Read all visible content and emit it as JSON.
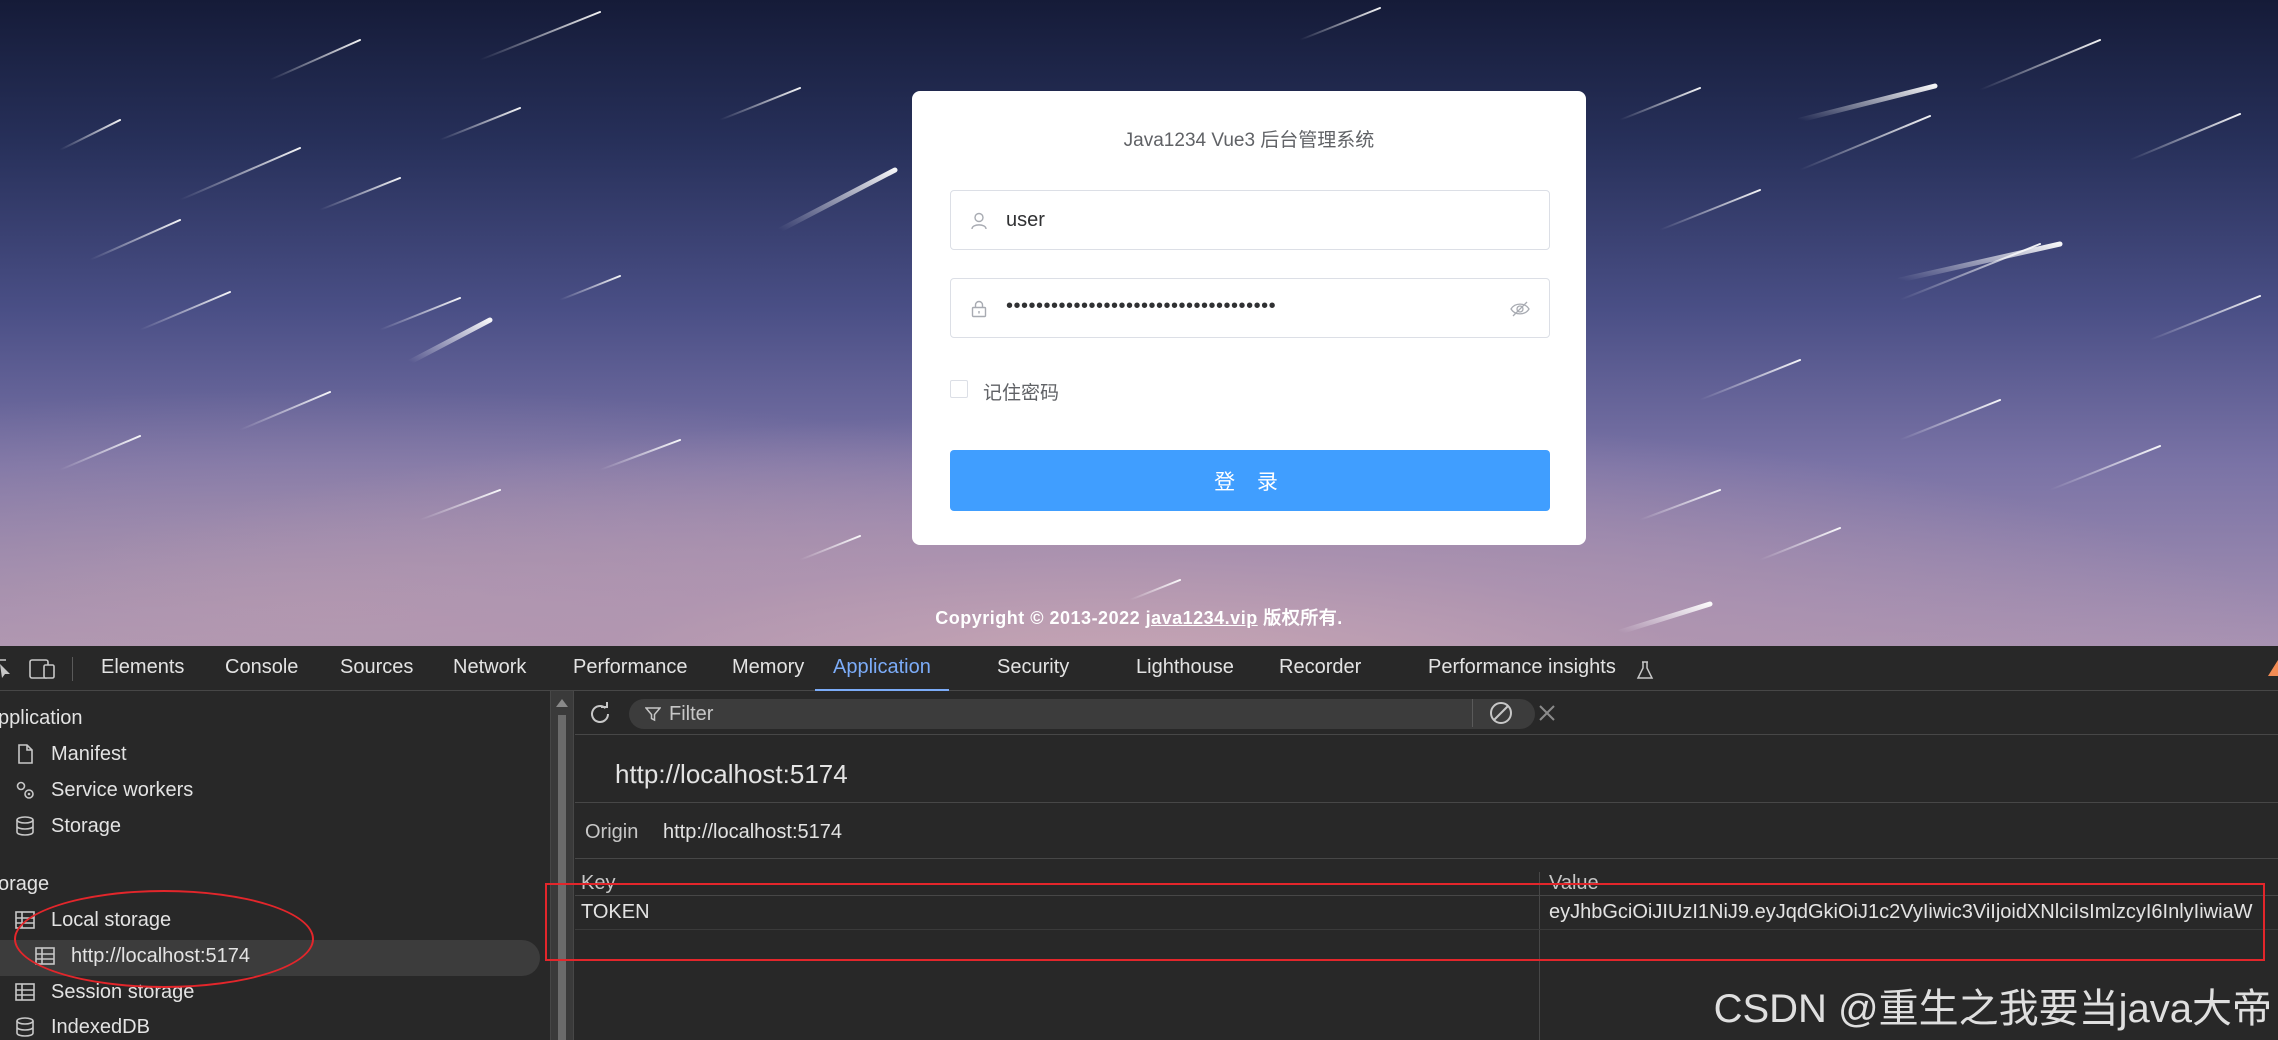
{
  "login": {
    "title": "Java1234 Vue3 后台管理系统",
    "username_value": "user",
    "password_value": "••••••••••••••••••••••••••••••••••••",
    "remember_label": "记住密码",
    "login_button": "登 录",
    "copyright_prefix": "Copyright © 2013-2022 ",
    "copyright_link": "java1234.vip",
    "copyright_suffix": " 版权所有."
  },
  "devtools": {
    "tabs": [
      "Elements",
      "Console",
      "Sources",
      "Network",
      "Performance",
      "Memory",
      "Application",
      "Security",
      "Lighthouse",
      "Recorder",
      "Performance insights"
    ],
    "active_tab": "Application",
    "sidebar": {
      "section_application": "pplication",
      "manifest": "Manifest",
      "service_workers": "Service workers",
      "storage": "Storage",
      "section_storage": "orage",
      "local_storage": "Local storage",
      "local_origin": "http://localhost:5174",
      "session_storage": "Session storage",
      "indexeddb": "IndexedDB"
    },
    "filter_placeholder": "Filter",
    "origin_title": "http://localhost:5174",
    "origin_label": "Origin",
    "origin_value": "http://localhost:5174",
    "table": {
      "headers": [
        "Key",
        "Value"
      ],
      "rows": [
        {
          "key": "TOKEN",
          "value": "eyJhbGciOiJIUzI1NiJ9.eyJqdGkiOiJ1c2VyIiwic3ViIjoidXNlciIsImlzcyI6InlyIiwiaW"
        }
      ]
    },
    "accent_color": "#7cacf8"
  },
  "watermark": "CSDN @重生之我要当java大帝"
}
